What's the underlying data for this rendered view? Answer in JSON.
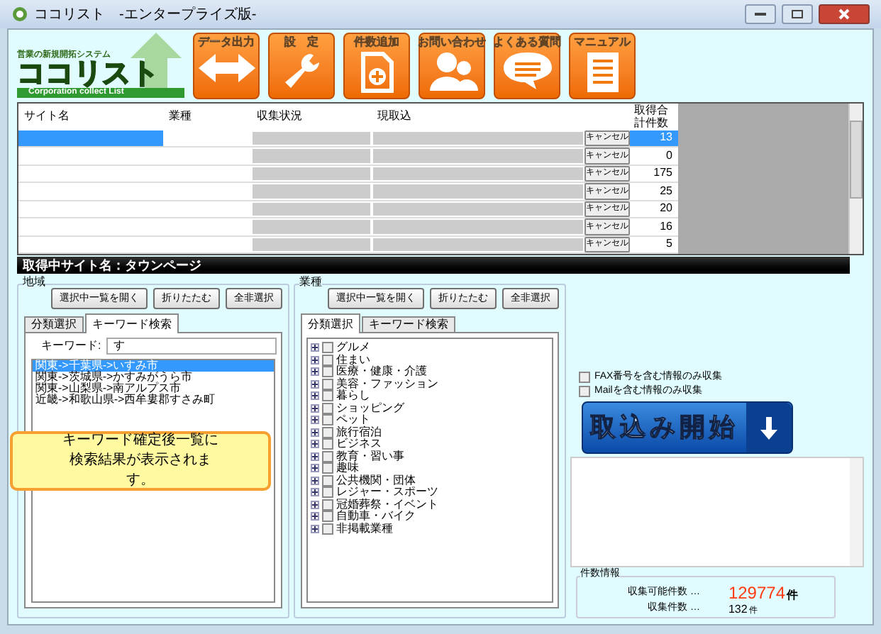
{
  "window": {
    "title": "ココリスト　-エンタープライズ版-"
  },
  "logo": {
    "tagline": "営業の新規開拓システム",
    "name": "ココリスト",
    "subtitle": "Corporation collect List"
  },
  "toolbar": [
    {
      "label": "データ出力",
      "kind": "export"
    },
    {
      "label": "設　定",
      "kind": "settings"
    },
    {
      "label": "件数追加",
      "kind": "add"
    },
    {
      "label": "お問い合わせ",
      "kind": "contact"
    },
    {
      "label": "よくある質問",
      "kind": "faq"
    },
    {
      "label": "マニュアル",
      "kind": "manual"
    }
  ],
  "table": {
    "columns": [
      "サイト名",
      "業種",
      "収集状況",
      "現取込",
      "取得合計件数"
    ],
    "rows": [
      {
        "selected": true,
        "button": "キャンセル",
        "count": "13"
      },
      {
        "selected": false,
        "button": "キャンセル",
        "count": "0"
      },
      {
        "selected": false,
        "button": "キャンセル",
        "count": "175"
      },
      {
        "selected": false,
        "button": "キャンセル",
        "count": "25"
      },
      {
        "selected": false,
        "button": "キャンセル",
        "count": "20"
      },
      {
        "selected": false,
        "button": "キャンセル",
        "count": "16"
      },
      {
        "selected": false,
        "button": "キャンセル",
        "count": "5"
      }
    ]
  },
  "status_banner": "取得中サイト名：タウンページ",
  "region": {
    "title": "地域",
    "buttons": [
      "選択中一覧を開く",
      "折りたたむ",
      "全非選択"
    ],
    "tabs": [
      {
        "label": "分類選択",
        "selected": false
      },
      {
        "label": "キーワード検索",
        "selected": true
      }
    ],
    "keyword_label": "キーワード:",
    "keyword": "す",
    "results": [
      {
        "text": "関東->千葉県->いすみ市",
        "selected": true
      },
      {
        "text": "関東->茨城県->かすみがうら市",
        "selected": false
      },
      {
        "text": "関東->山梨県->南アルプス市",
        "selected": false
      },
      {
        "text": "近畿->和歌山県->西牟婁郡すさみ町",
        "selected": false
      }
    ],
    "callout": "キーワード確定後一覧に検索結果が表示されます。"
  },
  "industry": {
    "title": "業種",
    "buttons": [
      "選択中一覧を開く",
      "折りたたむ",
      "全非選択"
    ],
    "tabs": [
      {
        "label": "分類選択",
        "selected": true
      },
      {
        "label": "キーワード検索",
        "selected": false
      }
    ],
    "tree": [
      {
        "label": "グルメ",
        "checked": false
      },
      {
        "label": "住まい",
        "checked": false
      },
      {
        "label": "医療・健康・介護",
        "checked": false
      },
      {
        "label": "美容・ファッション",
        "checked": false
      },
      {
        "label": "暮らし",
        "checked": false
      },
      {
        "label": "ショッピング",
        "checked": false
      },
      {
        "label": "ペット",
        "checked": false
      },
      {
        "label": "旅行宿泊",
        "checked": false
      },
      {
        "label": "ビジネス",
        "checked": false
      },
      {
        "label": "教育・習い事",
        "checked": false
      },
      {
        "label": "趣味",
        "checked": false
      },
      {
        "label": "公共機関・団体",
        "checked": false
      },
      {
        "label": "レジャー・スポーツ",
        "checked": false
      },
      {
        "label": "冠婚葬祭・イベント",
        "checked": false
      },
      {
        "label": "自動車・バイク",
        "checked": false
      },
      {
        "label": "非掲載業種",
        "checked": false
      }
    ]
  },
  "options": [
    {
      "label": "FAX番号を含む情報のみ収集",
      "checked": false
    },
    {
      "label": "Mailを含む情報のみ収集",
      "checked": false
    }
  ],
  "start_button": "取込み開始",
  "counts": {
    "title": "件数情報",
    "available_label": "収集可能件数 …",
    "available": "129774",
    "available_unit": "件",
    "collected_label": "収集件数 …",
    "collected": "132",
    "collected_unit": "件"
  }
}
